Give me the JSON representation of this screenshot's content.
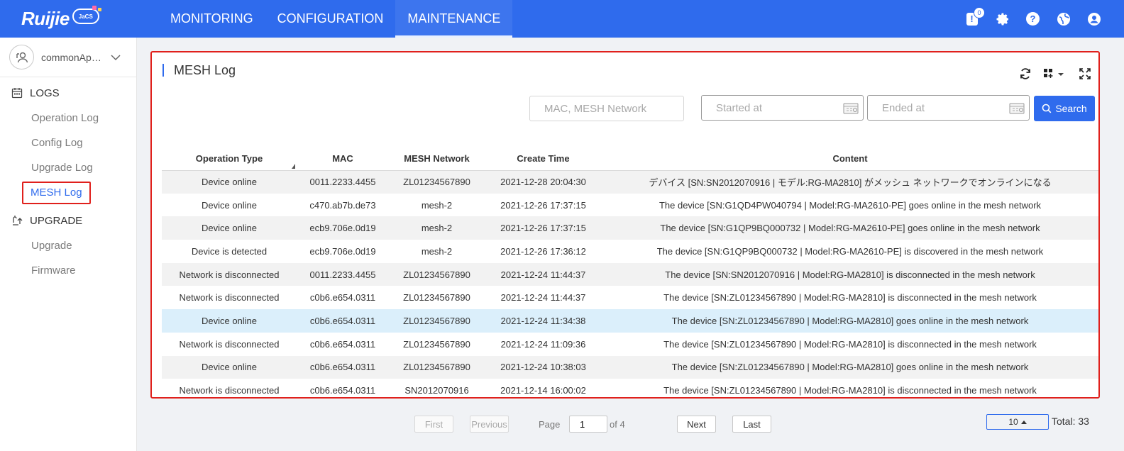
{
  "app": {
    "logo": "Ruijie",
    "logo_badge": "JaCS",
    "nav": [
      "MONITORING",
      "CONFIGURATION",
      "MAINTENANCE"
    ],
    "alert_count": "0",
    "top_icons": [
      "alert-icon",
      "gear-icon",
      "help-icon",
      "globe-icon",
      "user-icon"
    ]
  },
  "sidebar": {
    "account": "commonApar...",
    "groups": [
      {
        "title": "LOGS",
        "icon": "calendar-icon",
        "items": [
          "Operation Log",
          "Config Log",
          "Upgrade Log",
          "MESH Log"
        ]
      },
      {
        "title": "UPGRADE",
        "icon": "upgrade-icon",
        "items": [
          "Upgrade",
          "Firmware"
        ]
      }
    ],
    "active_item": "MESH Log"
  },
  "panel": {
    "title": "MESH Log",
    "search_placeholder": "MAC, MESH Network",
    "start_placeholder": "Started at",
    "end_placeholder": "Ended at",
    "search_label": "Search"
  },
  "table": {
    "columns": [
      "Operation Type",
      "MAC",
      "MESH Network",
      "Create Time",
      "Content"
    ],
    "rows": [
      [
        "Device online",
        "0011.2233.4455",
        "ZL01234567890",
        "2021-12-28 20:04:30",
        "デバイス [SN:SN2012070916 | モデル:RG-MA2810] がメッシュ ネットワークでオンラインになる"
      ],
      [
        "Device online",
        "c470.ab7b.de73",
        "mesh-2",
        "2021-12-26 17:37:15",
        "The device [SN:G1QD4PW040794 | Model:RG-MA2610-PE] goes online in the mesh network"
      ],
      [
        "Device online",
        "ecb9.706e.0d19",
        "mesh-2",
        "2021-12-26 17:37:15",
        "The device [SN:G1QP9BQ000732 | Model:RG-MA2610-PE] goes online in the mesh network"
      ],
      [
        "Device is detected",
        "ecb9.706e.0d19",
        "mesh-2",
        "2021-12-26 17:36:12",
        "The device [SN:G1QP9BQ000732 | Model:RG-MA2610-PE] is discovered in the mesh network"
      ],
      [
        "Network is disconnected",
        "0011.2233.4455",
        "ZL01234567890",
        "2021-12-24 11:44:37",
        "The device [SN:SN2012070916 | Model:RG-MA2810] is disconnected in the mesh network"
      ],
      [
        "Network is disconnected",
        "c0b6.e654.0311",
        "ZL01234567890",
        "2021-12-24 11:44:37",
        "The device [SN:ZL01234567890 | Model:RG-MA2810] is disconnected in the mesh network"
      ],
      [
        "Device online",
        "c0b6.e654.0311",
        "ZL01234567890",
        "2021-12-24 11:34:38",
        "The device [SN:ZL01234567890 | Model:RG-MA2810] goes online in the mesh network"
      ],
      [
        "Network is disconnected",
        "c0b6.e654.0311",
        "ZL01234567890",
        "2021-12-24 11:09:36",
        "The device [SN:ZL01234567890 | Model:RG-MA2810] is disconnected in the mesh network"
      ],
      [
        "Device online",
        "c0b6.e654.0311",
        "ZL01234567890",
        "2021-12-24 10:38:03",
        "The device [SN:ZL01234567890 | Model:RG-MA2810] goes online in the mesh network"
      ],
      [
        "Network is disconnected",
        "c0b6.e654.0311",
        "SN2012070916",
        "2021-12-14 16:00:02",
        "The device [SN:ZL01234567890 | Model:RG-MA2810] is disconnected in the mesh network"
      ]
    ],
    "highlight_row": 6
  },
  "pagination": {
    "first": "First",
    "previous": "Previous",
    "page_label": "Page",
    "page": "1",
    "of": "of 4",
    "next": "Next",
    "last": "Last",
    "page_size": "10",
    "total": "Total: 33"
  },
  "colors": {
    "primary": "#2f6bed",
    "highlight_frame": "#e0201c",
    "row_highlight": "#dbeffb"
  }
}
